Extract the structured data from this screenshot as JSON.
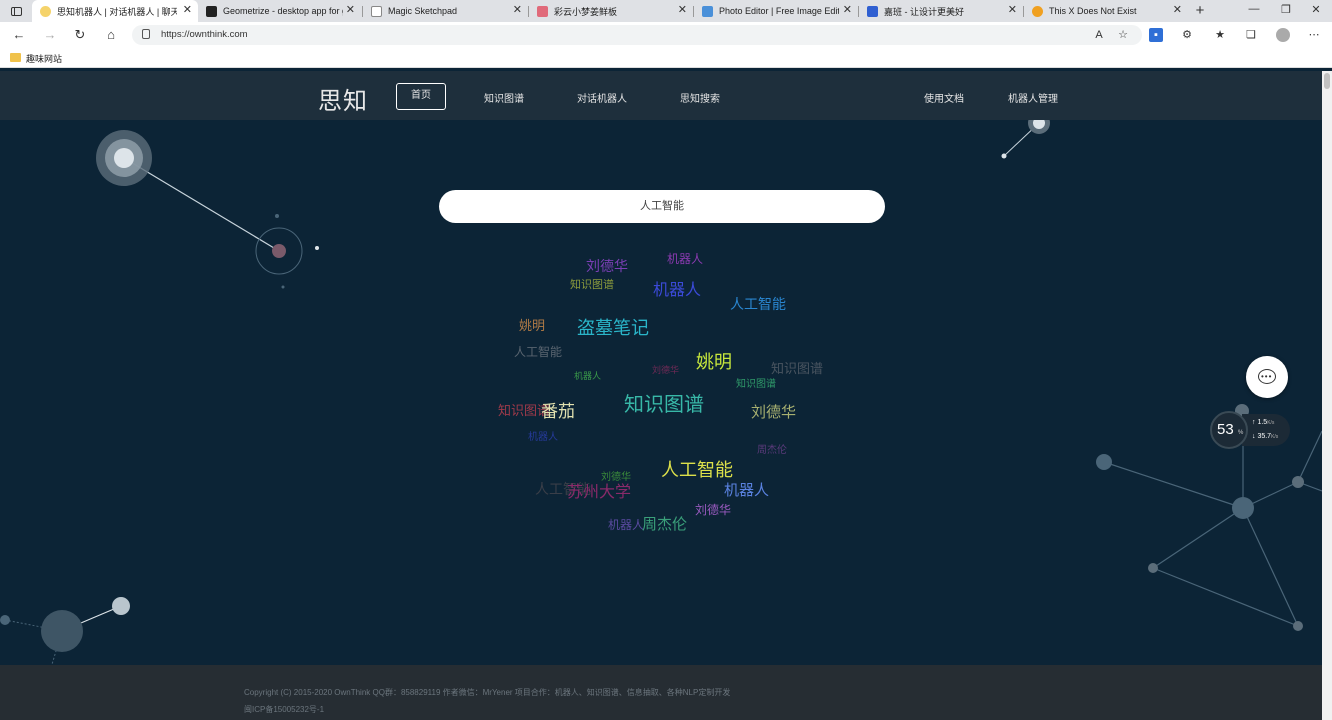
{
  "browser": {
    "tabs": [
      {
        "title": "思知机器人 | 对话机器人 | 聊天",
        "color": "#f5d36b",
        "active": true
      },
      {
        "title": "Geometrize - desktop app for g",
        "color": "#222222",
        "active": false
      },
      {
        "title": "Magic Sketchpad",
        "color": "#888888",
        "active": false
      },
      {
        "title": "彩云小梦姜鲜板",
        "color": "#e06a7a",
        "active": false
      },
      {
        "title": "Photo Editor | Free Image Editin",
        "color": "#4a90d9",
        "active": false
      },
      {
        "title": "嘉班 - 让设计更美好",
        "color": "#2f5fd1",
        "active": false
      },
      {
        "title": "This X Does Not Exist",
        "color": "#f0a020",
        "active": false
      }
    ],
    "url": "https://ownthink.com",
    "bookmark": "趣味网站"
  },
  "site": {
    "logo": "思知",
    "nav": {
      "home": "首页",
      "kg": "知识图谱",
      "bot": "对话机器人",
      "search": "思知搜索",
      "docs": "使用文档",
      "manage": "机器人管理"
    },
    "search_value": "人工智能"
  },
  "word_cloud": [
    {
      "text": "刘德华",
      "color": "#7b3fb5",
      "size": 14
    },
    {
      "text": "机器人",
      "color": "#8a3ab0",
      "size": 12
    },
    {
      "text": "知识图谱",
      "color": "#8b9a3c",
      "size": 11
    },
    {
      "text": "机器人",
      "color": "#3b4ad8",
      "size": 16
    },
    {
      "text": "人工智能",
      "color": "#2a86d0",
      "size": 14
    },
    {
      "text": "姚明",
      "color": "#b07a45",
      "size": 13
    },
    {
      "text": "盗墓笔记",
      "color": "#2ab5c9",
      "size": 18
    },
    {
      "text": "人工智能",
      "color": "#5a6570",
      "size": 12
    },
    {
      "text": "知识图谱",
      "color": "#4a5560",
      "size": 13
    },
    {
      "text": "姚明",
      "color": "#c8e83c",
      "size": 18
    },
    {
      "text": "刘德华",
      "color": "#6e2a55",
      "size": 9
    },
    {
      "text": "机器人",
      "color": "#3a9a4a",
      "size": 9
    },
    {
      "text": "知识图谱",
      "color": "#2f9a6a",
      "size": 10
    },
    {
      "text": "知识图谱",
      "color": "#a03a4a",
      "size": 13
    },
    {
      "text": "番茄",
      "color": "#e2e2b0",
      "size": 17
    },
    {
      "text": "知识图谱",
      "color": "#38b8a8",
      "size": 20
    },
    {
      "text": "刘德华",
      "color": "#a8b070",
      "size": 15
    },
    {
      "text": "机器人",
      "color": "#263a9a",
      "size": 10
    },
    {
      "text": "周杰伦",
      "color": "#5a3a7a",
      "size": 10
    },
    {
      "text": "人工智能",
      "color": "#dce04a",
      "size": 18
    },
    {
      "text": "刘德华",
      "color": "#3a8a3a",
      "size": 10
    },
    {
      "text": "人工智能",
      "color": "#3a3e48",
      "size": 14
    },
    {
      "text": "苏州大学",
      "color": "#8a2a6a",
      "size": 16
    },
    {
      "text": "机器人",
      "color": "#5a82e0",
      "size": 15
    },
    {
      "text": "刘德华",
      "color": "#9a5ac0",
      "size": 12
    },
    {
      "text": "机器人",
      "color": "#5a4aa0",
      "size": 12
    },
    {
      "text": "周杰伦",
      "color": "#3aa07a",
      "size": 15
    }
  ],
  "widget": {
    "percent": "53",
    "percent_sign": "%",
    "upload": "1.5",
    "download": "35.7",
    "unit": "K/s"
  },
  "footer": {
    "line1": "Copyright (C) 2015-2020 OwnThink QQ群：858829119 作者微信：MrYener 项目合作：机器人、知识图谱、信息抽取、各种NLP定制开发",
    "line2": "闽ICP备15005232号-1"
  }
}
